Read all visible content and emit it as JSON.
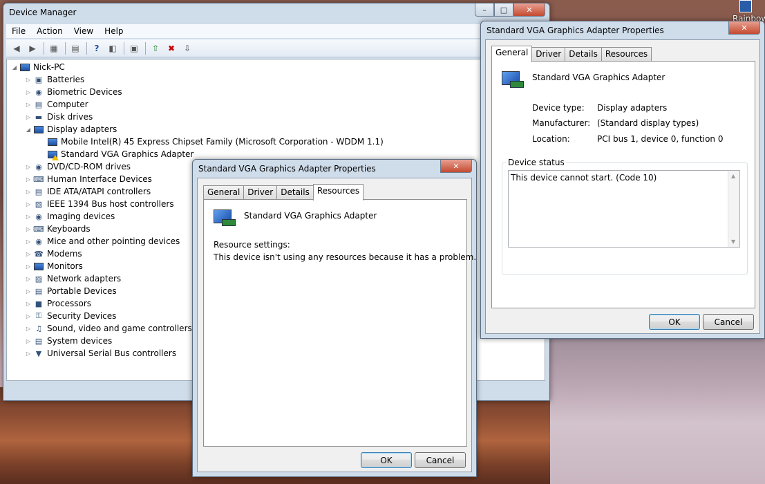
{
  "desktop": {
    "tile_label": "Rainbow"
  },
  "device_manager": {
    "title": "Device Manager",
    "menu": [
      "File",
      "Action",
      "View",
      "Help"
    ],
    "root": "Nick-PC",
    "categories": [
      "Batteries",
      "Biometric Devices",
      "Computer",
      "Disk drives",
      "Display adapters",
      "DVD/CD-ROM drives",
      "Human Interface Devices",
      "IDE ATA/ATAPI controllers",
      "IEEE 1394 Bus host controllers",
      "Imaging devices",
      "Keyboards",
      "Mice and other pointing devices",
      "Modems",
      "Monitors",
      "Network adapters",
      "Portable Devices",
      "Processors",
      "Security Devices",
      "Sound, video and game controllers",
      "System devices",
      "Universal Serial Bus controllers"
    ],
    "display_children": [
      "Mobile Intel(R) 45 Express Chipset Family (Microsoft Corporation - WDDM 1.1)",
      "Standard VGA Graphics Adapter"
    ]
  },
  "props_general": {
    "title": "Standard VGA Graphics Adapter Properties",
    "tabs": [
      "General",
      "Driver",
      "Details",
      "Resources"
    ],
    "device_name": "Standard VGA Graphics Adapter",
    "device_type_label": "Device type:",
    "device_type": "Display adapters",
    "manufacturer_label": "Manufacturer:",
    "manufacturer": "(Standard display types)",
    "location_label": "Location:",
    "location": "PCI bus 1, device 0, function 0",
    "status_group": "Device status",
    "status_text": "This device cannot start. (Code 10)",
    "ok": "OK",
    "cancel": "Cancel"
  },
  "props_resources": {
    "title": "Standard VGA Graphics Adapter Properties",
    "tabs": [
      "General",
      "Driver",
      "Details",
      "Resources"
    ],
    "device_name": "Standard VGA Graphics Adapter",
    "resource_label": "Resource settings:",
    "resource_text": "This device isn't using any resources because it has a problem.",
    "ok": "OK",
    "cancel": "Cancel"
  }
}
